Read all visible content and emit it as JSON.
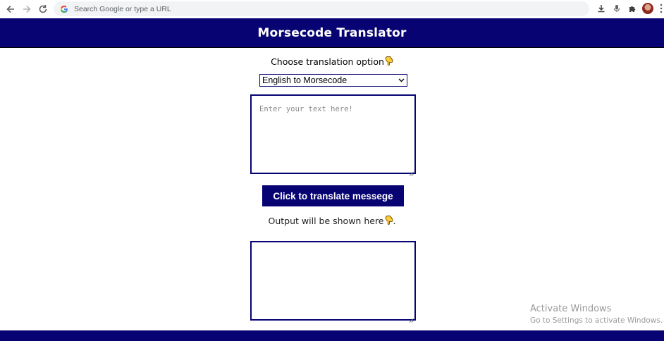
{
  "browser": {
    "omnibox_placeholder": "Search Google or type a URL",
    "icons": [
      "back-arrow-icon",
      "forward-arrow-icon",
      "reload-icon",
      "google-g-icon",
      "download-icon",
      "microphone-icon",
      "extensions-puzzle-icon",
      "profile-avatar",
      "menu-kebab-icon"
    ]
  },
  "app": {
    "title": "Morsecode Translator",
    "choose_label": "Choose translation option",
    "select": {
      "selected": "English to Morsecode"
    },
    "input": {
      "placeholder": "Enter your text here!",
      "value": ""
    },
    "translate_button": "Click to translate messege",
    "output_label": "Output will be shown here",
    "output_label_suffix": ".",
    "output": {
      "value": ""
    },
    "pointing_hand_icon": "pointing-down-hand-icon"
  },
  "watermark": {
    "title": "Activate Windows",
    "subtitle": "Go to Settings to activate Windows."
  },
  "colors": {
    "brand_navy": "#070373",
    "header_text": "#ffffff",
    "watermark": "#9a9a9a"
  }
}
